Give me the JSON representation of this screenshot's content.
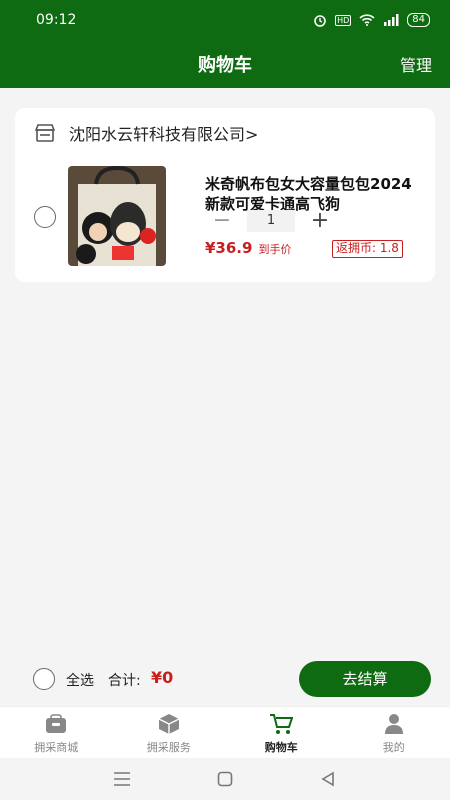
{
  "status_bar": {
    "time": "09:12",
    "battery": "84"
  },
  "header": {
    "title": "购物车",
    "manage_label": "管理"
  },
  "cart": {
    "shop_name": "沈阳水云轩科技有限公司>",
    "item": {
      "title": "米奇帆布包女大容量包包2024新款可爱卡通高飞狗",
      "quantity": "1",
      "price": "¥36.9",
      "price_note": "到手价",
      "rebate": "返拥币: 1.8"
    }
  },
  "bottom_bar": {
    "select_all_label": "全选",
    "total_label": "合计:",
    "total_value": "¥0",
    "checkout_label": "去结算"
  },
  "tabbar": {
    "tabs": [
      {
        "label": "拥采商城",
        "icon": "shop-icon",
        "active": false
      },
      {
        "label": "拥采服务",
        "icon": "box-icon",
        "active": false
      },
      {
        "label": "购物车",
        "icon": "cart-icon",
        "active": true
      },
      {
        "label": "我的",
        "icon": "user-icon",
        "active": false
      }
    ]
  },
  "colors": {
    "brand_green": "#0f6b12",
    "price_red": "#c81e1e"
  }
}
